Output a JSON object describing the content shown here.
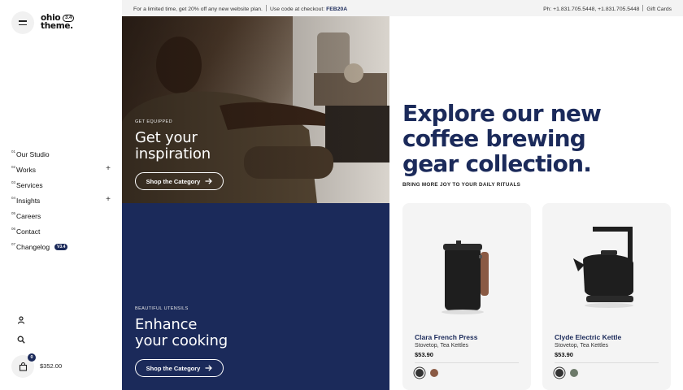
{
  "logo": {
    "text_line1": "ohio",
    "text_line2": "theme.",
    "version": "3.4"
  },
  "nav": {
    "items": [
      {
        "num": "01",
        "label": "Our Studio",
        "has_plus": false
      },
      {
        "num": "02",
        "label": "Works",
        "has_plus": true
      },
      {
        "num": "03",
        "label": "Services",
        "has_plus": false
      },
      {
        "num": "04",
        "label": "Insights",
        "has_plus": true
      },
      {
        "num": "05",
        "label": "Careers",
        "has_plus": false
      },
      {
        "num": "06",
        "label": "Contact",
        "has_plus": false
      },
      {
        "num": "07",
        "label": "Changelog",
        "has_plus": false,
        "badge": "V3.4"
      }
    ]
  },
  "cart": {
    "count": "0",
    "total": "$352.00"
  },
  "topbar": {
    "promo": "For a limited time, get 20% off any new website plan.",
    "code_label": "Use code at checkout:",
    "code": "FEB20A",
    "phone": "Ph: +1.831.705.5448, +1.831.705.5448",
    "gift": "Gift Cards"
  },
  "categories": [
    {
      "eyebrow": "GET EQUIPPED",
      "title_line1": "Get your",
      "title_line2": "inspiration",
      "button": "Shop the Category"
    },
    {
      "eyebrow": "BEAUTIFUL UTENSILS",
      "title_line1": "Enhance",
      "title_line2": "your cooking",
      "button": "Shop the Category"
    }
  ],
  "hero": {
    "headline_line1": "Explore our new",
    "headline_line2": "coffee brewing",
    "headline_line3": "gear collection.",
    "subhead": "BRING MORE JOY TO YOUR DAILY RITUALS"
  },
  "products": [
    {
      "name": "Clara French Press",
      "category": "Stovetop, Tea Kettles",
      "price": "$53.90",
      "swatches": [
        "#333333",
        "#8a5a44"
      ]
    },
    {
      "name": "Clyde Electric Kettle",
      "category": "Stovetop, Tea Kettles",
      "price": "$53.90",
      "swatches": [
        "#333333",
        "#6d7a6a"
      ]
    }
  ],
  "colors": {
    "brand_navy": "#1b2a5a",
    "topbar_bg": "#f3f3f3",
    "card_bg": "#f4f4f4"
  }
}
